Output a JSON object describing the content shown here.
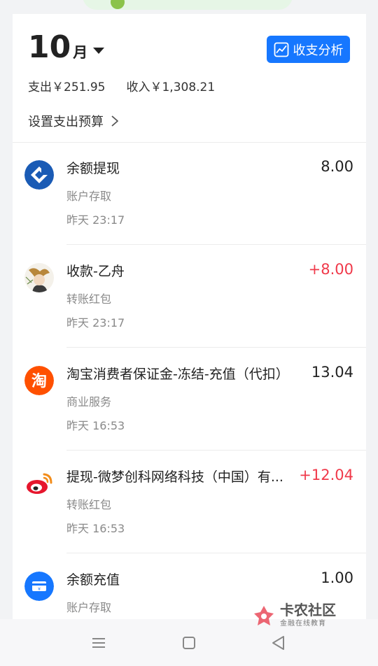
{
  "header": {
    "month_number": "10",
    "month_unit": "月",
    "analysis_button": "收支分析",
    "expense_total": "支出￥251.95",
    "income_total": "收入￥1,308.21",
    "budget_link": "设置支出预算"
  },
  "transactions": [
    {
      "title": "余额提现",
      "category": "账户存取",
      "time": "昨天 23:17",
      "amount": "8.00",
      "icon": "ccb-bank-logo-icon",
      "positive": false
    },
    {
      "title": "收款-乙舟",
      "category": "转账红包",
      "time": "昨天 23:17",
      "amount": "+8.00",
      "icon": "avatar-icon",
      "positive": true
    },
    {
      "title": "淘宝消费者保证金-冻结-充值（代扣）",
      "category": "商业服务",
      "time": "昨天 16:53",
      "amount": "13.04",
      "icon": "taobao-icon",
      "positive": false
    },
    {
      "title": "提现-微梦创科网络科技（中国）有...",
      "category": "转账红包",
      "time": "昨天 16:53",
      "amount": "+12.04",
      "icon": "weibo-icon",
      "positive": true
    },
    {
      "title": "余额充值",
      "category": "账户存取",
      "time": "",
      "amount": "1.00",
      "icon": "balance-recharge-icon",
      "positive": false
    }
  ],
  "watermark": {
    "title": "卡农社区",
    "subtitle": "金融在线教育"
  },
  "colors": {
    "accent": "#1677ff",
    "positive_amount": "#f0394a"
  }
}
